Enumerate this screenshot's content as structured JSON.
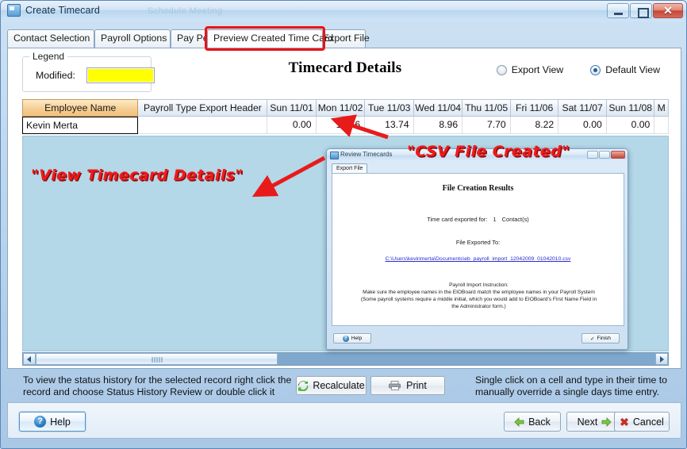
{
  "window": {
    "title": "Create Timecard",
    "ghost_background_text": "Schedule Meeting",
    "buttons": {
      "minimize": "minimize-button",
      "maximize": "maximize-button",
      "close": "✕"
    }
  },
  "tabs": [
    {
      "label": "Contact Selection",
      "active": false
    },
    {
      "label": "Payroll Options",
      "active": false
    },
    {
      "label": "Pay Period",
      "active": false
    },
    {
      "label": "Preview Created Time Card",
      "active": true
    },
    {
      "label": "Export File",
      "active": false
    }
  ],
  "legend": {
    "title": "Legend",
    "modified_label": "Modified:",
    "modified_color": "#ffff00"
  },
  "page_title": "Timecard Details",
  "view_options": [
    {
      "label": "Export View",
      "selected": false
    },
    {
      "label": "Default View",
      "selected": true
    }
  ],
  "grid": {
    "columns": [
      "Employee Name",
      "Payroll Type Export Header",
      "Sun 11/01",
      "Mon 11/02",
      "Tue 11/03",
      "Wed 11/04",
      "Thu 11/05",
      "Fri 11/06",
      "Sat 11/07",
      "Sun 11/08",
      "M"
    ],
    "rows": [
      {
        "employee_name": "Kevin Merta",
        "payroll_type_export_header": "",
        "values": [
          "0.00",
          "13.46",
          "13.74",
          "8.96",
          "7.70",
          "8.22",
          "0.00",
          "0.00",
          ""
        ]
      }
    ]
  },
  "footer_notes": {
    "left": "To view the status history for the selected record right click the record and choose Status History Review or double click it",
    "right": "Single click on a cell and type in their time to manually override a single days time entry."
  },
  "action_buttons": {
    "recalculate": "Recalculate",
    "print": "Print"
  },
  "dialog_buttons": {
    "help": "Help",
    "back": "Back",
    "next": "Next",
    "cancel": "Cancel"
  },
  "inner_dialog": {
    "title": "Review Timecards",
    "tab_label": "Export File",
    "heading": "File Creation Results",
    "exported_for_label": "Time card exported for:",
    "exported_count": "1",
    "contacts_label": "Contact(s)",
    "file_exported_to_label": "File Exported To:",
    "file_path": "C:\\Users\\kevinmerta\\Documents\\eb_payroll_import_12042009_01042010.csv",
    "instruction_heading": "Payroll Import Instruction:",
    "instruction_line1": "Make sure the employee names in the EIOBoard match the employee names in your Payroll System",
    "instruction_line2": "(Some payroll systems require a middle initial, which you would add to EIOBoard's First Name Field in",
    "instruction_line3": "the Administrator form.)",
    "help_button": "Help",
    "finish_button": "Finish"
  },
  "annotations": [
    {
      "text": "\"View Timecard Details\"",
      "color": "#ef1b1b"
    },
    {
      "text": "\"CSV File Created\"",
      "color": "#ef1b1b"
    }
  ],
  "colors": {
    "highlight_border": "#ee1111",
    "modified_swatch": "#ffff00",
    "accent_header": "#f0c07c",
    "preview_background": "#b4d8e8"
  }
}
